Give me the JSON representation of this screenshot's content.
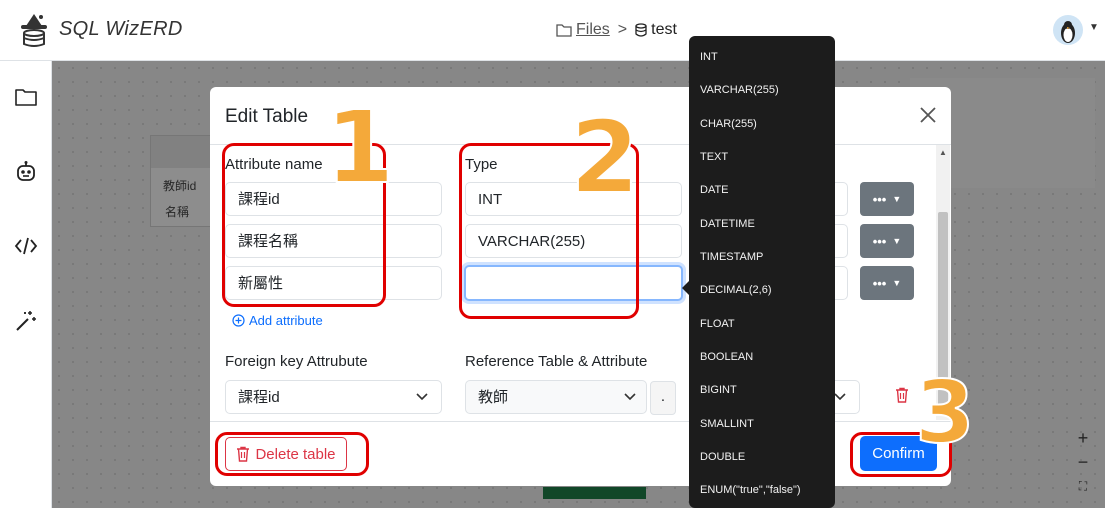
{
  "app": {
    "title": "SQL WizERD"
  },
  "breadcrumb": {
    "files_label": "Files",
    "separator": ">",
    "current": "test"
  },
  "sidebar": {
    "items": [
      {
        "icon": "folder-icon"
      },
      {
        "icon": "robot-icon"
      },
      {
        "icon": "code-icon"
      },
      {
        "icon": "magic-wand-icon"
      }
    ]
  },
  "canvas": {
    "bg_table_rows": [
      "教師id",
      "名稱"
    ],
    "zoom": {
      "in": "+",
      "out": "−",
      "fit": "⛶"
    }
  },
  "modal": {
    "title": "Edit Table",
    "attribute_name_label": "Attribute name",
    "type_label": "Type",
    "attributes": [
      {
        "name": "課程id",
        "type": "INT"
      },
      {
        "name": "課程名稱",
        "type": "VARCHAR(255)"
      },
      {
        "name": "新屬性",
        "type": ""
      }
    ],
    "add_attribute": "Add attribute",
    "foreign_key_label": "Foreign key Attrubute",
    "foreign_key_value": "課程id",
    "reference_label": "Reference Table & Attribute",
    "reference_table_value": "教師",
    "reference_dot": ".",
    "delete_button": "Delete table",
    "confirm_button": "Confirm"
  },
  "type_menu": {
    "options": [
      "INT",
      "VARCHAR(255)",
      "CHAR(255)",
      "TEXT",
      "DATE",
      "DATETIME",
      "TIMESTAMP",
      "DECIMAL(2,6)",
      "FLOAT",
      "BOOLEAN",
      "BIGINT",
      "SMALLINT",
      "DOUBLE",
      "ENUM(\"true\",\"false\")"
    ]
  },
  "annotations": {
    "step1": "1",
    "step2": "2",
    "step3": "3"
  },
  "colors": {
    "primary": "#0d6efd",
    "danger": "#dc3545",
    "annotation_red": "#e00000",
    "annotation_orange": "#f4a93a",
    "menu_bg": "#1c1c1c"
  }
}
